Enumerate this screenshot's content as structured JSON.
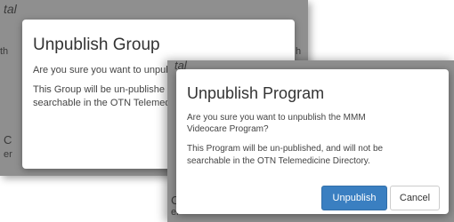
{
  "background_fragments": {
    "top_italic": "tal",
    "left_mid": "th",
    "left_lower": "C",
    "left_lower2": "er",
    "right_mid": "h",
    "front_top": "tal",
    "front_lower": "C",
    "front_lower2": "er"
  },
  "back_dialog": {
    "title": "Unpublish Group",
    "question": "Are you sure you want to unpub",
    "description_line1": "This Group will be un-publishe",
    "description_line2": "searchable in the OTN Telemedi"
  },
  "front_dialog": {
    "title": "Unpublish Program",
    "question_line1": "Are you sure you want to unpublish the MMM",
    "question_line2": "Videocare Program?",
    "description_line1": "This Program will be un-published, and will not be",
    "description_line2": "searchable in the OTN Telemedicine Directory.",
    "unpublish_label": "Unpublish",
    "cancel_label": "Cancel"
  },
  "colors": {
    "primary": "#3a7fc1",
    "backdrop": "#8f8f8f"
  }
}
